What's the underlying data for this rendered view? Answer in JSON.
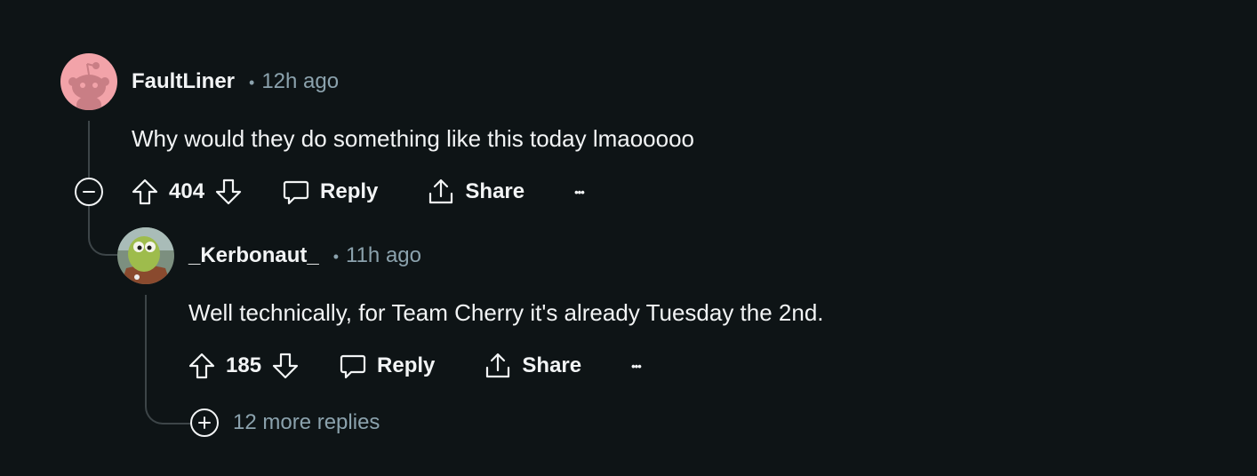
{
  "comments": [
    {
      "username": "FaultLiner",
      "separator": "•",
      "time": "12h ago",
      "text": "Why would they do something like this today lmaooooo",
      "score": "404",
      "reply_label": "Reply",
      "share_label": "Share",
      "more_label": "•••",
      "avatar_color": "#f2a3a9"
    },
    {
      "username": "_Kerbonaut_",
      "separator": "•",
      "time": "11h ago",
      "text": "Well technically, for Team Cherry it's already Tuesday the 2nd.",
      "score": "185",
      "reply_label": "Reply",
      "share_label": "Share",
      "more_label": "•••"
    }
  ],
  "more_replies": "12 more replies",
  "colors": {
    "background": "#0e1416",
    "text": "#f2f4f5",
    "muted": "#8ba2ad",
    "thread_line": "#3d4548"
  }
}
